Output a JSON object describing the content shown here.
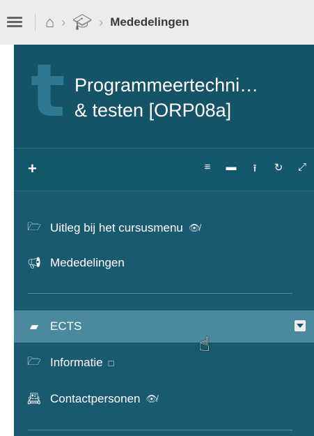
{
  "breadcrumb": {
    "current": "Mededelingen"
  },
  "course": {
    "letter": "t",
    "title_line1": "Programmeertechni…",
    "title_line2": "& testen [ORP08a]"
  },
  "toolbar": {
    "add_label": "+"
  },
  "menu": {
    "items": [
      {
        "label": "Uitleg bij het cursusmenu",
        "icon": "folder-open-icon",
        "suffix_icon": "eye-slash-icon"
      },
      {
        "label": "Mededelingen",
        "icon": "bullhorn-icon"
      },
      {
        "label": "ECTS",
        "icon": "book-icon",
        "active": true
      },
      {
        "label": "Informatie",
        "icon": "folder-open-icon",
        "suffix_icon": "square-icon"
      },
      {
        "label": "Contactpersonen",
        "icon": "id-card-icon",
        "suffix_icon": "eye-slash-icon"
      }
    ]
  },
  "colors": {
    "panel": "#1a5a6e",
    "active_row": "#4a8a9c",
    "topbar": "#ececec"
  }
}
